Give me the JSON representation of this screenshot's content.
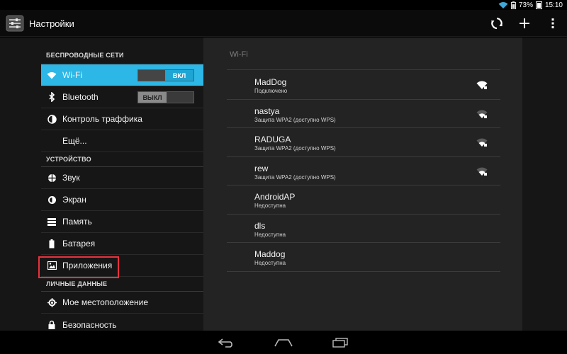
{
  "status_bar": {
    "battery": "73%",
    "time": "15:10"
  },
  "action_bar": {
    "title": "Настройки"
  },
  "sidebar": {
    "sections": {
      "wireless": "БЕСПРОВОДНЫЕ СЕТИ",
      "device": "УСТРОЙСТВО",
      "personal": "ЛИЧНЫЕ ДАННЫЕ"
    },
    "items": {
      "wifi": {
        "label": "Wi-Fi",
        "toggle": "ВКЛ"
      },
      "bluetooth": {
        "label": "Bluetooth",
        "toggle": "ВЫКЛ"
      },
      "traffic": {
        "label": "Контроль траффика"
      },
      "more": {
        "label": "Ещё..."
      },
      "sound": {
        "label": "Звук"
      },
      "screen": {
        "label": "Экран"
      },
      "memory": {
        "label": "Память"
      },
      "battery": {
        "label": "Батарея"
      },
      "apps": {
        "label": "Приложения"
      },
      "location": {
        "label": "Мое местоположение"
      },
      "security": {
        "label": "Безопасность"
      }
    }
  },
  "wifi_panel": {
    "title": "Wi-Fi",
    "networks": [
      {
        "name": "MadDog",
        "status": "Подключено",
        "signal": "strong"
      },
      {
        "name": "nastya",
        "status": "Защита WPA2 (доступно WPS)",
        "signal": "weak"
      },
      {
        "name": "RADUGA",
        "status": "Защита WPA2 (доступно WPS)",
        "signal": "weak"
      },
      {
        "name": "rew",
        "status": "Защита WPA2 (доступно WPS)",
        "signal": "weak"
      },
      {
        "name": "AndroidAP",
        "status": "Недоступна",
        "signal": "none"
      },
      {
        "name": "dls",
        "status": "Недоступна",
        "signal": "none"
      },
      {
        "name": "Maddog",
        "status": "Недоступна",
        "signal": "none"
      }
    ]
  },
  "colors": {
    "accent": "#2db7e6",
    "highlight_box": "#e8323d"
  }
}
